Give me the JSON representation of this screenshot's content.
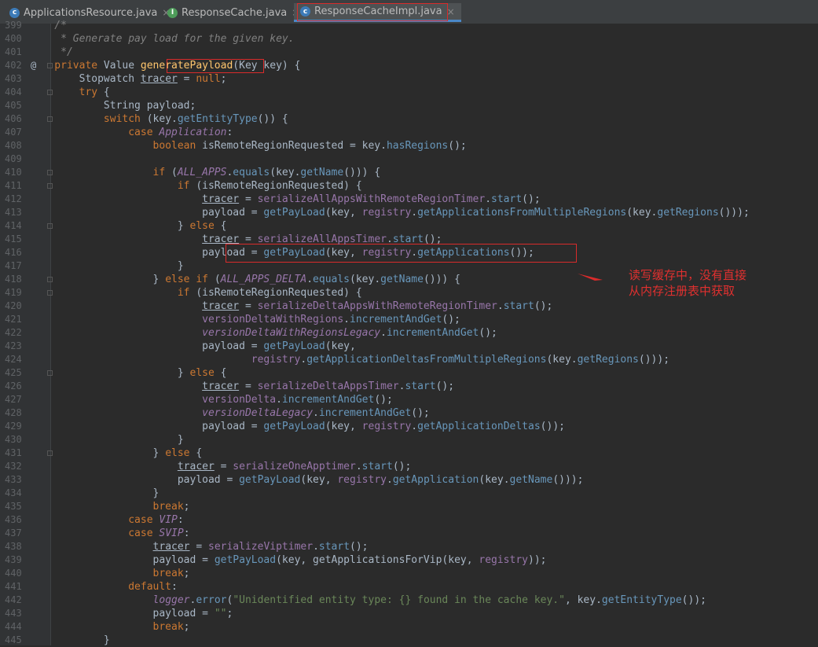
{
  "tabs": [
    {
      "label": "ApplicationsResource.java",
      "close": "×"
    },
    {
      "label": "ResponseCache.java",
      "close": "×"
    },
    {
      "label": "ResponseCacheImpl.java",
      "close": "×"
    }
  ],
  "annotation": {
    "line1": "读写缓存中，没有直接",
    "line2": "从内存注册表中获取"
  },
  "gutter_marker": "@",
  "colors": {
    "background": "#2b2b2b",
    "keyword": "#cc7832",
    "string": "#6a8759",
    "method_call": "#6897bb",
    "field": "#9876aa",
    "highlight_box": "#d92b2b"
  },
  "lines": [
    {
      "n": "399",
      "t": [
        [
          "cm",
          "    /*"
        ]
      ]
    },
    {
      "n": "400",
      "t": [
        [
          "cm",
          "     * Generate pay load for the given key."
        ]
      ]
    },
    {
      "n": "401",
      "t": [
        [
          "cm",
          "     */"
        ]
      ]
    },
    {
      "n": "402",
      "t": [
        [
          "kw",
          "    private "
        ],
        [
          "",
          "Value "
        ],
        [
          "fn",
          "generatePayload"
        ],
        [
          "",
          "(Key key) {"
        ]
      ]
    },
    {
      "n": "403",
      "t": [
        [
          "",
          "        Stopwatch "
        ],
        [
          "ul",
          "tracer"
        ],
        [
          "",
          " = "
        ],
        [
          "kw",
          "null"
        ],
        [
          "",
          ";"
        ]
      ]
    },
    {
      "n": "404",
      "t": [
        [
          "kw",
          "        try "
        ],
        [
          "",
          "{"
        ]
      ]
    },
    {
      "n": "405",
      "t": [
        [
          "",
          "            String payload;"
        ]
      ]
    },
    {
      "n": "406",
      "t": [
        [
          "kw",
          "            switch "
        ],
        [
          "",
          "(key."
        ],
        [
          "mt",
          "getEntityType"
        ],
        [
          "",
          "()) {"
        ]
      ]
    },
    {
      "n": "407",
      "t": [
        [
          "kw",
          "                case "
        ],
        [
          "sfi",
          "Application"
        ],
        [
          "",
          ":"
        ]
      ]
    },
    {
      "n": "408",
      "t": [
        [
          "kw",
          "                    boolean "
        ],
        [
          "",
          "isRemoteRegionRequested = key."
        ],
        [
          "mt",
          "hasRegions"
        ],
        [
          "",
          "();"
        ]
      ]
    },
    {
      "n": "409",
      "t": [
        [
          "",
          ""
        ]
      ]
    },
    {
      "n": "410",
      "t": [
        [
          "kw",
          "                    if "
        ],
        [
          "",
          "("
        ],
        [
          "sfi",
          "ALL_APPS"
        ],
        [
          "",
          "."
        ],
        [
          "mt",
          "equals"
        ],
        [
          "",
          "(key."
        ],
        [
          "mt",
          "getName"
        ],
        [
          "",
          "())) {"
        ]
      ]
    },
    {
      "n": "411",
      "t": [
        [
          "kw",
          "                        if "
        ],
        [
          "",
          "(isRemoteRegionRequested) {"
        ]
      ]
    },
    {
      "n": "412",
      "t": [
        [
          "",
          "                            "
        ],
        [
          "ul",
          "tracer"
        ],
        [
          "",
          " = "
        ],
        [
          "fld",
          "serializeAllAppsWithRemoteRegionTimer"
        ],
        [
          "",
          "."
        ],
        [
          "mt",
          "start"
        ],
        [
          "",
          "();"
        ]
      ]
    },
    {
      "n": "413",
      "t": [
        [
          "",
          "                            payload = "
        ],
        [
          "mt",
          "getPayLoad"
        ],
        [
          "",
          "(key, "
        ],
        [
          "fld",
          "registry"
        ],
        [
          "",
          "."
        ],
        [
          "mt",
          "getApplicationsFromMultipleRegions"
        ],
        [
          "",
          "(key."
        ],
        [
          "mt",
          "getRegions"
        ],
        [
          "",
          "()));"
        ]
      ]
    },
    {
      "n": "414",
      "t": [
        [
          "",
          "                        } "
        ],
        [
          "kw",
          "else "
        ],
        [
          "",
          "{"
        ]
      ]
    },
    {
      "n": "415",
      "t": [
        [
          "",
          "                            "
        ],
        [
          "ul",
          "tracer"
        ],
        [
          "",
          " = "
        ],
        [
          "fld",
          "serializeAllAppsTimer"
        ],
        [
          "",
          "."
        ],
        [
          "mt",
          "start"
        ],
        [
          "",
          "();"
        ]
      ]
    },
    {
      "n": "416",
      "t": [
        [
          "",
          "                            payload = "
        ],
        [
          "mt",
          "getPayLoad"
        ],
        [
          "",
          "(key, "
        ],
        [
          "fld",
          "registry"
        ],
        [
          "",
          "."
        ],
        [
          "mt",
          "getApplications"
        ],
        [
          "",
          "());"
        ]
      ]
    },
    {
      "n": "417",
      "t": [
        [
          "",
          "                        }"
        ]
      ]
    },
    {
      "n": "418",
      "t": [
        [
          "",
          "                    } "
        ],
        [
          "kw",
          "else if "
        ],
        [
          "",
          "("
        ],
        [
          "sfi",
          "ALL_APPS_DELTA"
        ],
        [
          "",
          "."
        ],
        [
          "mt",
          "equals"
        ],
        [
          "",
          "(key."
        ],
        [
          "mt",
          "getName"
        ],
        [
          "",
          "())) {"
        ]
      ]
    },
    {
      "n": "419",
      "t": [
        [
          "kw",
          "                        if "
        ],
        [
          "",
          "(isRemoteRegionRequested) {"
        ]
      ]
    },
    {
      "n": "420",
      "t": [
        [
          "",
          "                            "
        ],
        [
          "ul",
          "tracer"
        ],
        [
          "",
          " = "
        ],
        [
          "fld",
          "serializeDeltaAppsWithRemoteRegionTimer"
        ],
        [
          "",
          "."
        ],
        [
          "mt",
          "start"
        ],
        [
          "",
          "();"
        ]
      ]
    },
    {
      "n": "421",
      "t": [
        [
          "",
          "                            "
        ],
        [
          "fld",
          "versionDeltaWithRegions"
        ],
        [
          "",
          "."
        ],
        [
          "mt",
          "incrementAndGet"
        ],
        [
          "",
          "();"
        ]
      ]
    },
    {
      "n": "422",
      "t": [
        [
          "",
          "                            "
        ],
        [
          "sfi",
          "versionDeltaWithRegionsLegacy"
        ],
        [
          "",
          "."
        ],
        [
          "mt",
          "incrementAndGet"
        ],
        [
          "",
          "();"
        ]
      ]
    },
    {
      "n": "423",
      "t": [
        [
          "",
          "                            payload = "
        ],
        [
          "mt",
          "getPayLoad"
        ],
        [
          "",
          "(key,"
        ]
      ]
    },
    {
      "n": "424",
      "t": [
        [
          "",
          "                                    "
        ],
        [
          "fld",
          "registry"
        ],
        [
          "",
          "."
        ],
        [
          "mt",
          "getApplicationDeltasFromMultipleRegions"
        ],
        [
          "",
          "(key."
        ],
        [
          "mt",
          "getRegions"
        ],
        [
          "",
          "()));"
        ]
      ]
    },
    {
      "n": "425",
      "t": [
        [
          "",
          "                        } "
        ],
        [
          "kw",
          "else "
        ],
        [
          "",
          "{"
        ]
      ]
    },
    {
      "n": "426",
      "t": [
        [
          "",
          "                            "
        ],
        [
          "ul",
          "tracer"
        ],
        [
          "",
          " = "
        ],
        [
          "fld",
          "serializeDeltaAppsTimer"
        ],
        [
          "",
          "."
        ],
        [
          "mt",
          "start"
        ],
        [
          "",
          "();"
        ]
      ]
    },
    {
      "n": "427",
      "t": [
        [
          "",
          "                            "
        ],
        [
          "fld",
          "versionDelta"
        ],
        [
          "",
          "."
        ],
        [
          "mt",
          "incrementAndGet"
        ],
        [
          "",
          "();"
        ]
      ]
    },
    {
      "n": "428",
      "t": [
        [
          "",
          "                            "
        ],
        [
          "sfi",
          "versionDeltaLegacy"
        ],
        [
          "",
          "."
        ],
        [
          "mt",
          "incrementAndGet"
        ],
        [
          "",
          "();"
        ]
      ]
    },
    {
      "n": "429",
      "t": [
        [
          "",
          "                            payload = "
        ],
        [
          "mt",
          "getPayLoad"
        ],
        [
          "",
          "(key, "
        ],
        [
          "fld",
          "registry"
        ],
        [
          "",
          "."
        ],
        [
          "mt",
          "getApplicationDeltas"
        ],
        [
          "",
          "());"
        ]
      ]
    },
    {
      "n": "430",
      "t": [
        [
          "",
          "                        }"
        ]
      ]
    },
    {
      "n": "431",
      "t": [
        [
          "",
          "                    } "
        ],
        [
          "kw",
          "else "
        ],
        [
          "",
          "{"
        ]
      ]
    },
    {
      "n": "432",
      "t": [
        [
          "",
          "                        "
        ],
        [
          "ul",
          "tracer"
        ],
        [
          "",
          " = "
        ],
        [
          "fld",
          "serializeOneApptimer"
        ],
        [
          "",
          "."
        ],
        [
          "mt",
          "start"
        ],
        [
          "",
          "();"
        ]
      ]
    },
    {
      "n": "433",
      "t": [
        [
          "",
          "                        payload = "
        ],
        [
          "mt",
          "getPayLoad"
        ],
        [
          "",
          "(key, "
        ],
        [
          "fld",
          "registry"
        ],
        [
          "",
          "."
        ],
        [
          "mt",
          "getApplication"
        ],
        [
          "",
          "(key."
        ],
        [
          "mt",
          "getName"
        ],
        [
          "",
          "()));"
        ]
      ]
    },
    {
      "n": "434",
      "t": [
        [
          "",
          "                    }"
        ]
      ]
    },
    {
      "n": "435",
      "t": [
        [
          "kw",
          "                    break"
        ],
        [
          "",
          ";"
        ]
      ]
    },
    {
      "n": "436",
      "t": [
        [
          "kw",
          "                case "
        ],
        [
          "sfi",
          "VIP"
        ],
        [
          "",
          ":"
        ]
      ]
    },
    {
      "n": "437",
      "t": [
        [
          "kw",
          "                case "
        ],
        [
          "sfi",
          "SVIP"
        ],
        [
          "",
          ":"
        ]
      ]
    },
    {
      "n": "438",
      "t": [
        [
          "",
          "                    "
        ],
        [
          "ul",
          "tracer"
        ],
        [
          "",
          " = "
        ],
        [
          "fld",
          "serializeViptimer"
        ],
        [
          "",
          "."
        ],
        [
          "mt",
          "start"
        ],
        [
          "",
          "();"
        ]
      ]
    },
    {
      "n": "439",
      "t": [
        [
          "",
          "                    payload = "
        ],
        [
          "mt",
          "getPayLoad"
        ],
        [
          "",
          "(key, getApplicationsForVip(key, "
        ],
        [
          "fld",
          "registry"
        ],
        [
          "",
          "));"
        ]
      ]
    },
    {
      "n": "440",
      "t": [
        [
          "kw",
          "                    break"
        ],
        [
          "",
          ";"
        ]
      ]
    },
    {
      "n": "441",
      "t": [
        [
          "kw",
          "                default"
        ],
        [
          "",
          ":"
        ]
      ]
    },
    {
      "n": "442",
      "t": [
        [
          "",
          "                    "
        ],
        [
          "sfi",
          "logger"
        ],
        [
          "",
          "."
        ],
        [
          "mt",
          "error"
        ],
        [
          "",
          "("
        ],
        [
          "st",
          "\"Unidentified entity type: {} found in the cache key.\""
        ],
        [
          "",
          ", key."
        ],
        [
          "mt",
          "getEntityType"
        ],
        [
          "",
          "());"
        ]
      ]
    },
    {
      "n": "443",
      "t": [
        [
          "",
          "                    payload = "
        ],
        [
          "st",
          "\"\""
        ],
        [
          "",
          ";"
        ]
      ]
    },
    {
      "n": "444",
      "t": [
        [
          "kw",
          "                    break"
        ],
        [
          "",
          ";"
        ]
      ]
    },
    {
      "n": "445",
      "t": [
        [
          "",
          "            }"
        ]
      ]
    }
  ]
}
